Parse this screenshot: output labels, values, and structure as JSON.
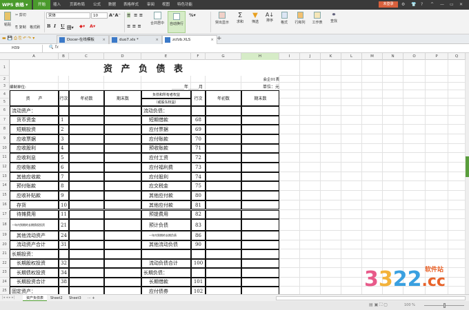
{
  "app": {
    "logo": "WPS 表格",
    "login": "未登录"
  },
  "menu": [
    "开始",
    "插入",
    "页面布局",
    "公式",
    "数据",
    "表格样式",
    "审阅",
    "视图",
    "特色功能"
  ],
  "window_controls": [
    "⚙",
    "👕",
    "?",
    "^",
    "—",
    "▭",
    "✕"
  ],
  "ribbon": {
    "paste": "粘贴",
    "cut": "剪切",
    "copy": "复制",
    "format_painter": "格式刷",
    "font": "宋体",
    "size": "10",
    "bold": "B",
    "italic": "I",
    "underline": "U",
    "merge": "合并居中",
    "wrap": "自动换行",
    "highlight": "突出显示",
    "sum": "求和",
    "filter": "筛选",
    "sort": "排序",
    "format": "格式",
    "rowcol": "行和列",
    "worksheet": "工作表",
    "find": "查找",
    "percent": "%"
  },
  "doc_tabs": [
    {
      "label": "Docer-在线模板",
      "active": false
    },
    {
      "label": "duo7.xls *",
      "active": false
    },
    {
      "label": "zcfzb.XLS",
      "active": true
    }
  ],
  "formula_bar": {
    "cell_ref": "H39",
    "fx": "fx",
    "value": ""
  },
  "columns": [
    "A",
    "B",
    "C",
    "D",
    "E",
    "F",
    "G",
    "H",
    "I",
    "J",
    "K",
    "L",
    "M",
    "N",
    "O",
    "P",
    "Q"
  ],
  "selected_column": "H",
  "sheet": {
    "title": "资 产 负 债 表",
    "form_no": "会企01表",
    "unit_label": "编制单位:",
    "date_label": "______年_____月",
    "currency": "单位：元",
    "headers": {
      "asset": "资　　产",
      "line": "行次",
      "begin": "年初数",
      "end": "期末数",
      "liab1": "负债和所有者权益",
      "liab2": "（或股东权益）",
      "line2": "行次",
      "begin2": "年初数",
      "end2": "期末数"
    },
    "rows": [
      {
        "a": "流动资产：",
        "b": "",
        "e": "流动负债：",
        "f": ""
      },
      {
        "a": "货币资金",
        "b": "1",
        "e": "短期借款",
        "f": "68"
      },
      {
        "a": "短期投资",
        "b": "2",
        "e": "应付票据",
        "f": "69"
      },
      {
        "a": "应收票据",
        "b": "3",
        "e": "应付账款",
        "f": "70"
      },
      {
        "a": "应收股利",
        "b": "4",
        "e": "预收账款",
        "f": "71"
      },
      {
        "a": "应收利息",
        "b": "5",
        "e": "应付工资",
        "f": "72"
      },
      {
        "a": "应收账款",
        "b": "6",
        "e": "应付福利费",
        "f": "73"
      },
      {
        "a": "其他应收款",
        "b": "7",
        "e": "应付股利",
        "f": "74"
      },
      {
        "a": "预付账款",
        "b": "8",
        "e": "应交税金",
        "f": "75"
      },
      {
        "a": "应收补贴款",
        "b": "9",
        "e": "其他应付款",
        "f": "80"
      },
      {
        "a": "存货",
        "b": "10",
        "e": "其他应付款",
        "f": "81"
      },
      {
        "a": "待摊费用",
        "b": "11",
        "e": "预提费用",
        "f": "82"
      },
      {
        "a": "一年内到期的长期债权投资",
        "b": "21",
        "e": "预计负债",
        "f": "83"
      },
      {
        "a": "其他流动资产",
        "b": "24",
        "e": "一年内到期的长期负债",
        "f": "86"
      },
      {
        "a": "流动资产合计",
        "b": "31",
        "e": "其他流动负债",
        "f": "90"
      },
      {
        "a": "长期投资：",
        "b": "",
        "e": "",
        "f": ""
      },
      {
        "a": "长期股权投资",
        "b": "32",
        "e": "流动负债合计",
        "f": "100"
      },
      {
        "a": "长期债权投资",
        "b": "34",
        "e": "长期负债：",
        "f": ""
      },
      {
        "a": "长期投资合计",
        "b": "38",
        "e": "长期借款",
        "f": "101"
      },
      {
        "a": "固定资产：",
        "b": "",
        "e": "应付债券",
        "f": "102"
      }
    ]
  },
  "sheet_tabs": [
    {
      "label": "资产负债表",
      "active": true
    },
    {
      "label": "Sheet2",
      "active": false
    },
    {
      "label": "Sheet3",
      "active": false
    }
  ],
  "sheet_tab_more": "··· +",
  "status": {
    "zoom": "100 %"
  },
  "watermark": "3322.cc 软件站"
}
